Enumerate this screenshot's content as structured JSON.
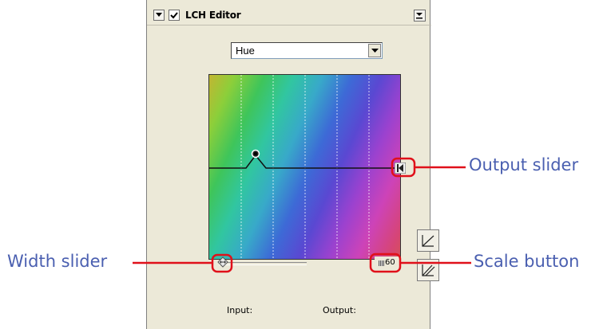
{
  "panel": {
    "title": "LCH Editor",
    "checked": true,
    "channel_select": {
      "value": "Hue",
      "options": [
        "Hue"
      ]
    },
    "scale_value": "60",
    "input_label": "Input:",
    "output_label": "Output:"
  },
  "callouts": {
    "output_slider": "Output slider",
    "width_slider": "Width slider",
    "scale_button": "Scale button"
  },
  "colors": {
    "callout_text": "#4a5fb0",
    "callout_line": "#e0101a",
    "panel_bg": "#ece9d8"
  },
  "icons": {
    "collapse": "triangle-down-icon",
    "check": "checkmark-icon",
    "menu": "menu-down-icon",
    "select_arrow": "chevron-down-icon",
    "curve": "curve-icon",
    "reset": "reset-curve-icon"
  }
}
